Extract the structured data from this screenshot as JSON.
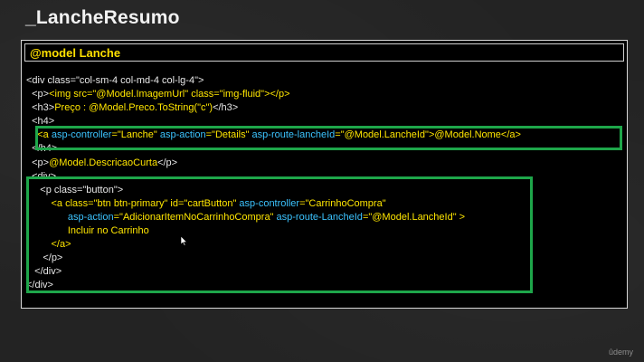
{
  "slide": {
    "title": "_LancheResumo"
  },
  "panel": {
    "model_line": "@model Lanche"
  },
  "code_lines": [
    [
      {
        "t": "<div class=\"col-sm-4 col-md-4 col-lg-4\">",
        "c": "w"
      }
    ],
    [
      {
        "t": "  <p>",
        "c": "w"
      },
      {
        "t": "<img src=\"@Model.ImagemUrl\" class=\"img-fluid\">",
        "c": "y"
      },
      {
        "t": "</p>",
        "c": "y"
      }
    ],
    [
      {
        "t": "  <h3>",
        "c": "w"
      },
      {
        "t": "Preço : @Model.Preco.ToString(\"c\")",
        "c": "y"
      },
      {
        "t": "</h3>",
        "c": "w"
      }
    ],
    [
      {
        "t": "  <h4>",
        "c": "w"
      }
    ],
    [
      {
        "t": "    <a ",
        "c": "y"
      },
      {
        "t": "asp-controller",
        "c": "c"
      },
      {
        "t": "=\"Lanche\" ",
        "c": "y"
      },
      {
        "t": "asp-action",
        "c": "c"
      },
      {
        "t": "=\"Details\" ",
        "c": "y"
      },
      {
        "t": "asp-route-lancheId",
        "c": "c"
      },
      {
        "t": "=\"@Model.LancheId\">@Model.Nome</a>",
        "c": "y"
      }
    ],
    [
      {
        "t": "  </h4>",
        "c": "w"
      }
    ],
    [
      {
        "t": "  <p>",
        "c": "w"
      },
      {
        "t": "@Model.DescricaoCurta",
        "c": "y"
      },
      {
        "t": "</p>",
        "c": "w"
      }
    ],
    [
      {
        "t": "  <div>",
        "c": "w"
      }
    ],
    [
      {
        "t": "     <p class=\"button\">",
        "c": "w"
      }
    ],
    [
      {
        "t": "         <a class=\"btn btn-primary\" id=\"cartButton\" ",
        "c": "y"
      },
      {
        "t": "asp-controller",
        "c": "c"
      },
      {
        "t": "=\"CarrinhoCompra\"",
        "c": "y"
      }
    ],
    [
      {
        "t": "               ",
        "c": "y"
      },
      {
        "t": "asp-action",
        "c": "c"
      },
      {
        "t": "=\"AdicionarItemNoCarrinhoCompra\" ",
        "c": "y"
      },
      {
        "t": "asp-route-LancheId",
        "c": "c"
      },
      {
        "t": "=\"@Model.LancheId\" >",
        "c": "y"
      }
    ],
    [
      {
        "t": "               Incluir no Carrinho",
        "c": "y"
      }
    ],
    [
      {
        "t": "         </a>",
        "c": "y"
      }
    ],
    [
      {
        "t": "      </p>",
        "c": "w"
      }
    ],
    [
      {
        "t": "   </div>",
        "c": "w"
      }
    ],
    [
      {
        "t": "</div>",
        "c": "w"
      }
    ]
  ],
  "watermark": "ûdemy",
  "icons": {
    "cursor": "mouse-pointer-icon"
  },
  "colors": {
    "background": "#232323",
    "code_bg": "#000000",
    "yellow": "#ffe600",
    "cyan": "#3cc4ff",
    "highlight": "#1ea64a"
  }
}
